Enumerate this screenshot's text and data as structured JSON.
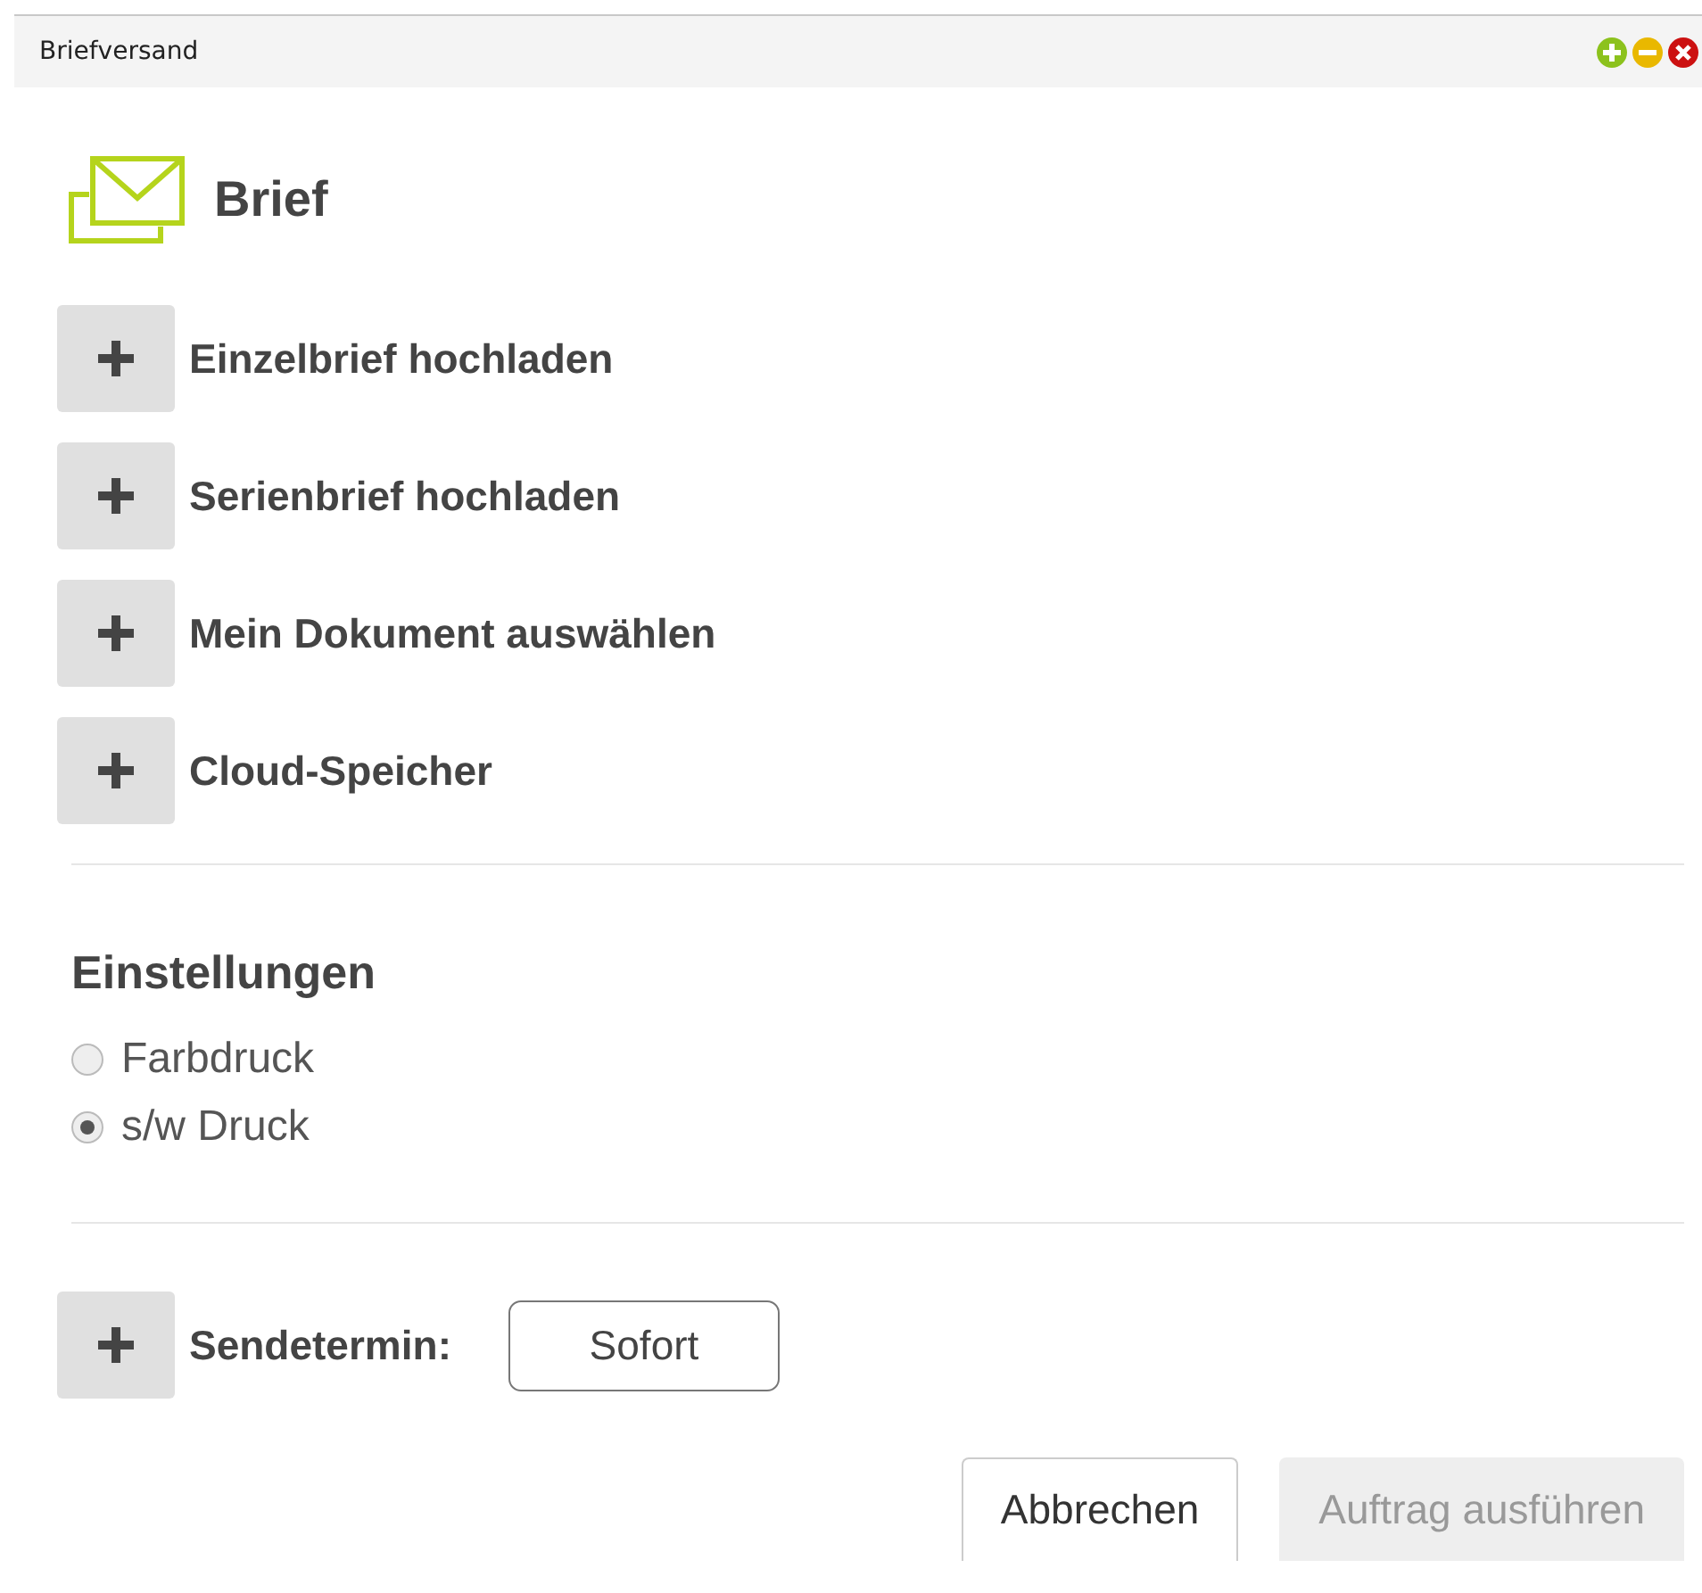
{
  "window": {
    "title": "Briefversand"
  },
  "header": {
    "title": "Brief"
  },
  "upload_actions": [
    {
      "label": "Einzelbrief hochladen"
    },
    {
      "label": "Serienbrief hochladen"
    },
    {
      "label": "Mein Dokument auswählen"
    },
    {
      "label": "Cloud-Speicher"
    }
  ],
  "settings": {
    "heading": "Einstellungen",
    "options": [
      {
        "label": "Farbdruck",
        "selected": false
      },
      {
        "label": "s/w Druck",
        "selected": true
      }
    ]
  },
  "schedule": {
    "label": "Sendetermin:",
    "value": "Sofort"
  },
  "buttons": [
    {
      "label": "Abbrechen",
      "disabled": false
    },
    {
      "label": "Auftrag ausführen",
      "disabled": true
    }
  ]
}
